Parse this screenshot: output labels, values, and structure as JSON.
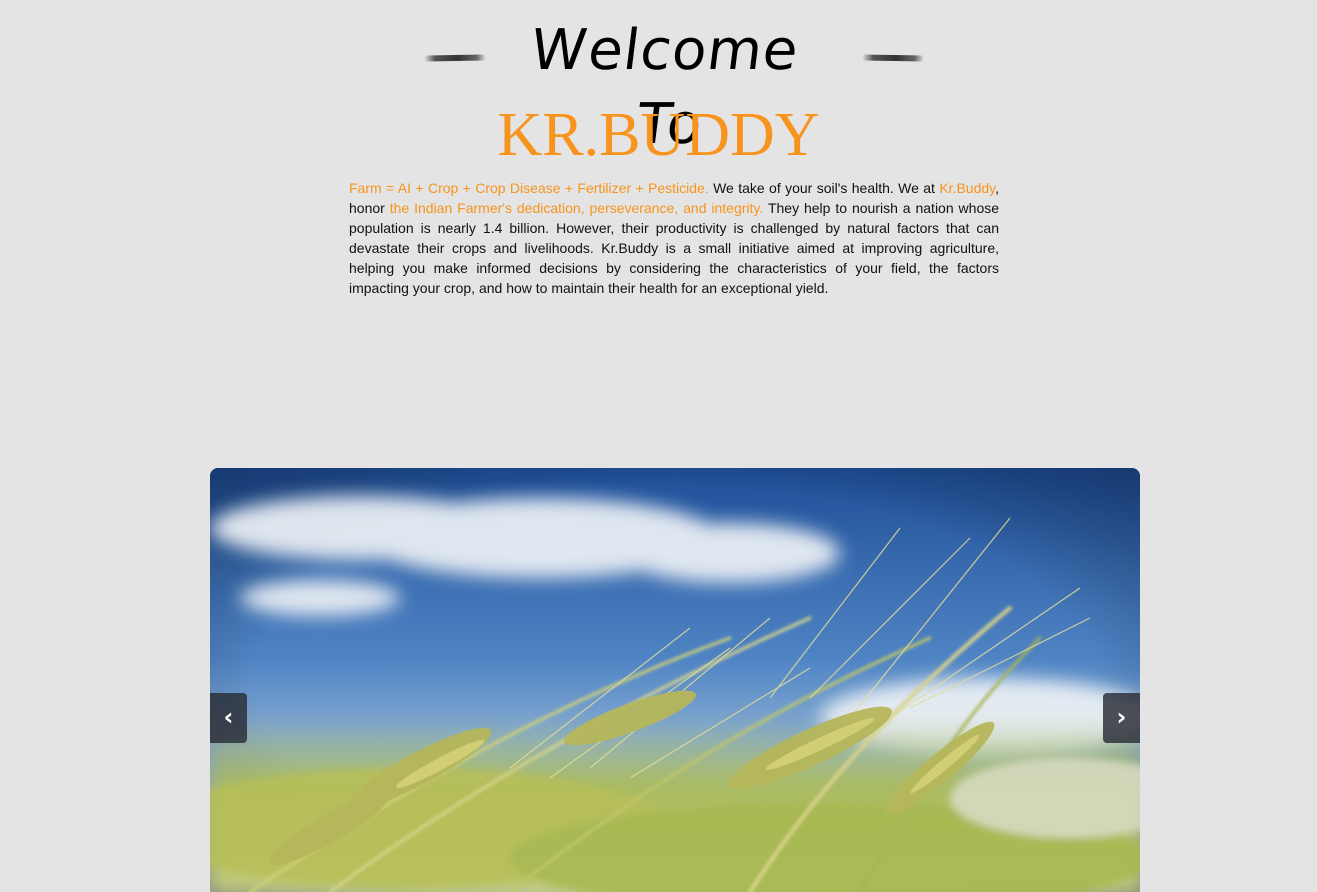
{
  "header": {
    "welcome": "Welcome To",
    "brand": "KR.BUDDY"
  },
  "intro": {
    "formula": "Farm = AI + Crop + Crop Disease + Fertilizer + Pesticide.",
    "text_1": " We take of your soil's health. We at ",
    "brand_ref": "Kr.Buddy",
    "text_2": ", honor ",
    "tribute": "the Indian Farmer's dedication, perseverance, and integrity.",
    "text_3": " They help to nourish a nation whose population is nearly 1.4 billion. However, their productivity is challenged by natural factors that can devastate their crops and livelihoods. Kr.Buddy is a small initiative aimed at improving agriculture, helping you make informed decisions by considering the characteristics of your field, the factors impacting your crop, and how to maintain their health for an exceptional yield."
  },
  "carousel": {
    "prev_label": "‹",
    "next_label": "›",
    "image_subject": "wheat field under blue sky"
  },
  "colors": {
    "accent": "#f7941d",
    "background": "#e4e4e4",
    "text": "#111111"
  }
}
